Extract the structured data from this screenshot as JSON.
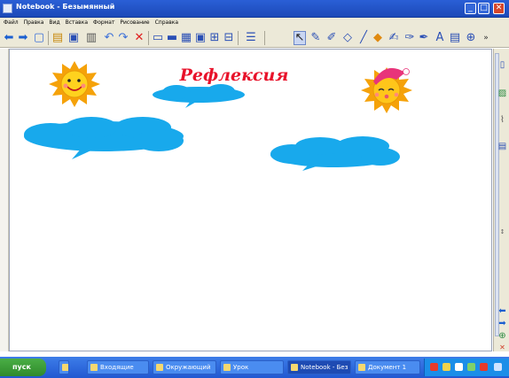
{
  "window": {
    "title": "Notebook - Безымянный",
    "controls": {
      "minimize": "_",
      "maximize": "□",
      "close": "✕"
    }
  },
  "menubar": [
    "Файл",
    "Правка",
    "Вид",
    "Вставка",
    "Формат",
    "Рисование",
    "Справка"
  ],
  "toolbar": {
    "icons": [
      "back-arrow-icon",
      "forward-arrow-icon",
      "new-page-icon",
      "open-icon",
      "save-icon",
      "paste-icon",
      "undo-icon",
      "redo-icon",
      "delete-icon",
      "screen-shade-icon",
      "show-screen-icon",
      "table-icon",
      "capture-icon",
      "full-screen-icon",
      "select-icon",
      "pen-icon",
      "creative-pen-icon",
      "eraser-icon",
      "line-icon",
      "shape-icon",
      "fill-icon",
      "magic-pen-icon",
      "text-icon",
      "properties-icon"
    ]
  },
  "slide": {
    "title": "Рефлексия",
    "colors": {
      "title": "#e8122a",
      "cloud": "#18a9ec",
      "sun": "#ffd21e",
      "sun_ray": "#f5a20a"
    }
  },
  "side_panel": {
    "icons": [
      "page-sorter-icon",
      "gallery-icon",
      "attachments-icon",
      "properties-panel-icon",
      "collapse-arrows-icon",
      "prev-page-icon",
      "next-page-icon",
      "add-page-icon",
      "close-panel-icon"
    ]
  },
  "taskbar": {
    "start_label": "пуск",
    "tasks": [
      "Входящие",
      "Окружающий",
      "Урок",
      "Notebook - Без",
      "Документ 1"
    ],
    "tray_icons": [
      "lang-icon",
      "volume-icon",
      "network-icon",
      "clock-icon"
    ]
  }
}
